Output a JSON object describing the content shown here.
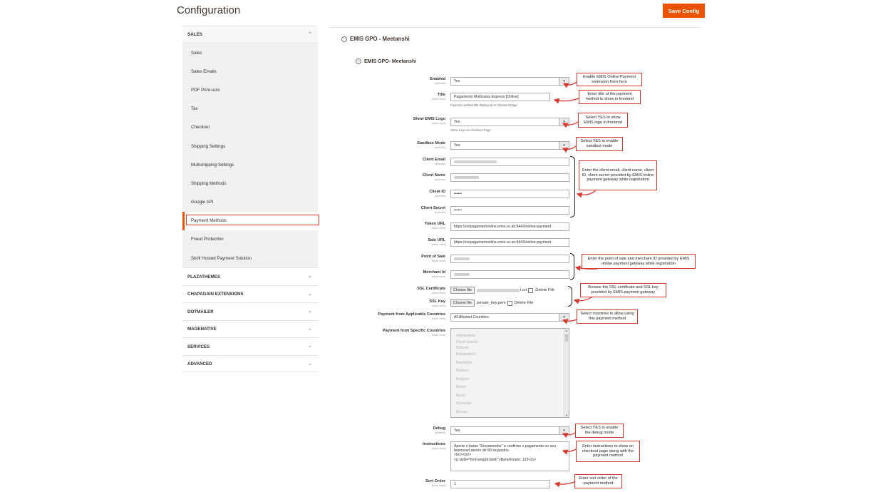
{
  "header": {
    "title": "Configuration",
    "save_label": "Save Config"
  },
  "sidebar": {
    "sales_section": "SALES",
    "sales_items": [
      "Sales",
      "Sales Emails",
      "PDF Print-outs",
      "Tax",
      "Checkout",
      "Shipping Settings",
      "Multishipping Settings",
      "Shipping Methods",
      "Google API",
      "Payment Methods",
      "Fraud Protection",
      "Skrill Hosted Payment Solution"
    ],
    "groups": [
      "PLAZATHEMES",
      "CHAPAGAIN EXTENSIONS",
      "DOTMAILER",
      "MAGENATIVE",
      "SERVICES",
      "ADVANCED"
    ]
  },
  "main": {
    "section_title": "EMIS GPO - Meetanshi",
    "subsection_title": "EMIS GPO- Meetanshi",
    "fields": {
      "enabled": {
        "label": "Enabled",
        "scope": "[website]",
        "value": "Yes"
      },
      "title": {
        "label": "Title",
        "scope": "[store view]",
        "value": "Pagamento Multicaixa Express [Online]",
        "note": "Payment method title displayed on Checkout Page"
      },
      "show_logo": {
        "label": "Show EMIS Logo",
        "scope": "[store view]",
        "value": "Yes",
        "note": "Show Logo on Checkout Page"
      },
      "sandbox": {
        "label": "Sandbox Mode",
        "scope": "[website]",
        "value": "Yes"
      },
      "client_email": {
        "label": "Client Email",
        "scope": "[website]"
      },
      "client_name": {
        "label": "Client Name",
        "scope": "[website]"
      },
      "client_id": {
        "label": "Client ID",
        "scope": "[website]",
        "value": "••••••"
      },
      "client_secret": {
        "label": "Client Secret",
        "scope": "[website]",
        "value": "••••••"
      },
      "token_url": {
        "label": "Token URL",
        "scope": "[store view]",
        "value": "https://cerpagamentonline.emis.co.ao:8443/online-payment"
      },
      "sale_url": {
        "label": "Sale URL",
        "scope": "[store view]",
        "value": "https://cerpagamentonline.emis.co.ao:9443/online-payment"
      },
      "point_of_sale": {
        "label": "Point of Sale",
        "scope": "[store view]"
      },
      "merchant_id": {
        "label": "Merchant Id",
        "scope": "[store view]"
      },
      "ssl_cert": {
        "label": "SSL Certificate",
        "scope": "[store view]",
        "button": "Choose file",
        "file_suffix": "t.crt",
        "delete": "Delete File"
      },
      "ssl_key": {
        "label": "SSL Key",
        "scope": "[store view]",
        "button": "Choose file",
        "file": "private_key.pem",
        "delete": "Delete File"
      },
      "applicable_countries": {
        "label": "Payment from Applicable Countries",
        "scope": "[store view]",
        "value": "All Allowed Countries"
      },
      "specific_countries": {
        "label": "Payment from Specific Countries",
        "scope": "[store view]",
        "options": [
          "Afghanistan",
          "Åland Islands",
          "Bahrain",
          "Bangladesh",
          "Barbados",
          "Belarus",
          "Belgium",
          "Belize",
          "Benin",
          "Bermuda",
          "Bhutan"
        ]
      },
      "debug": {
        "label": "Debug",
        "scope": "[website]",
        "value": "Yes"
      },
      "instructions": {
        "label": "Instructions",
        "scope": "[store view]",
        "value": "Aperte o batao \"Encomendar\" e confirme o pagamento no seu telemovel dentro de 90 segundos.\n<br/><br/>\n<p style=\"font-weight:bold;\">Beneficiario: 123</p>"
      },
      "sort_order": {
        "label": "Sort Order",
        "scope": "[store view]",
        "value": "1"
      }
    }
  },
  "callouts": {
    "enabled": "Enable EMIS Online Payment extension from here",
    "title": "Enter title of the payment method to show in frontend",
    "logo": "Select YES to show EMIS logo in frontend",
    "sandbox": "Select YES to enable sandbox mode",
    "client": "Enter the client email, client name, client ID, client secret provided by EMIS online payment gateway while registration",
    "pos": "Enter the point of sale and merchant ID provided by EMIS online payment gateway while registration",
    "ssl": "Browse the SSL certificate and SSL key provided by EMIS payment gateway",
    "countries": "Select countries to allow using this payment method",
    "debug": "Select YES to enable the debug mode",
    "instructions": "Enter instructions to show on checkout page along with the payment method",
    "sort": "Enter sort order of the payment method"
  },
  "colors": {
    "accent": "#eb5202",
    "callout_border": "#d6382e"
  }
}
